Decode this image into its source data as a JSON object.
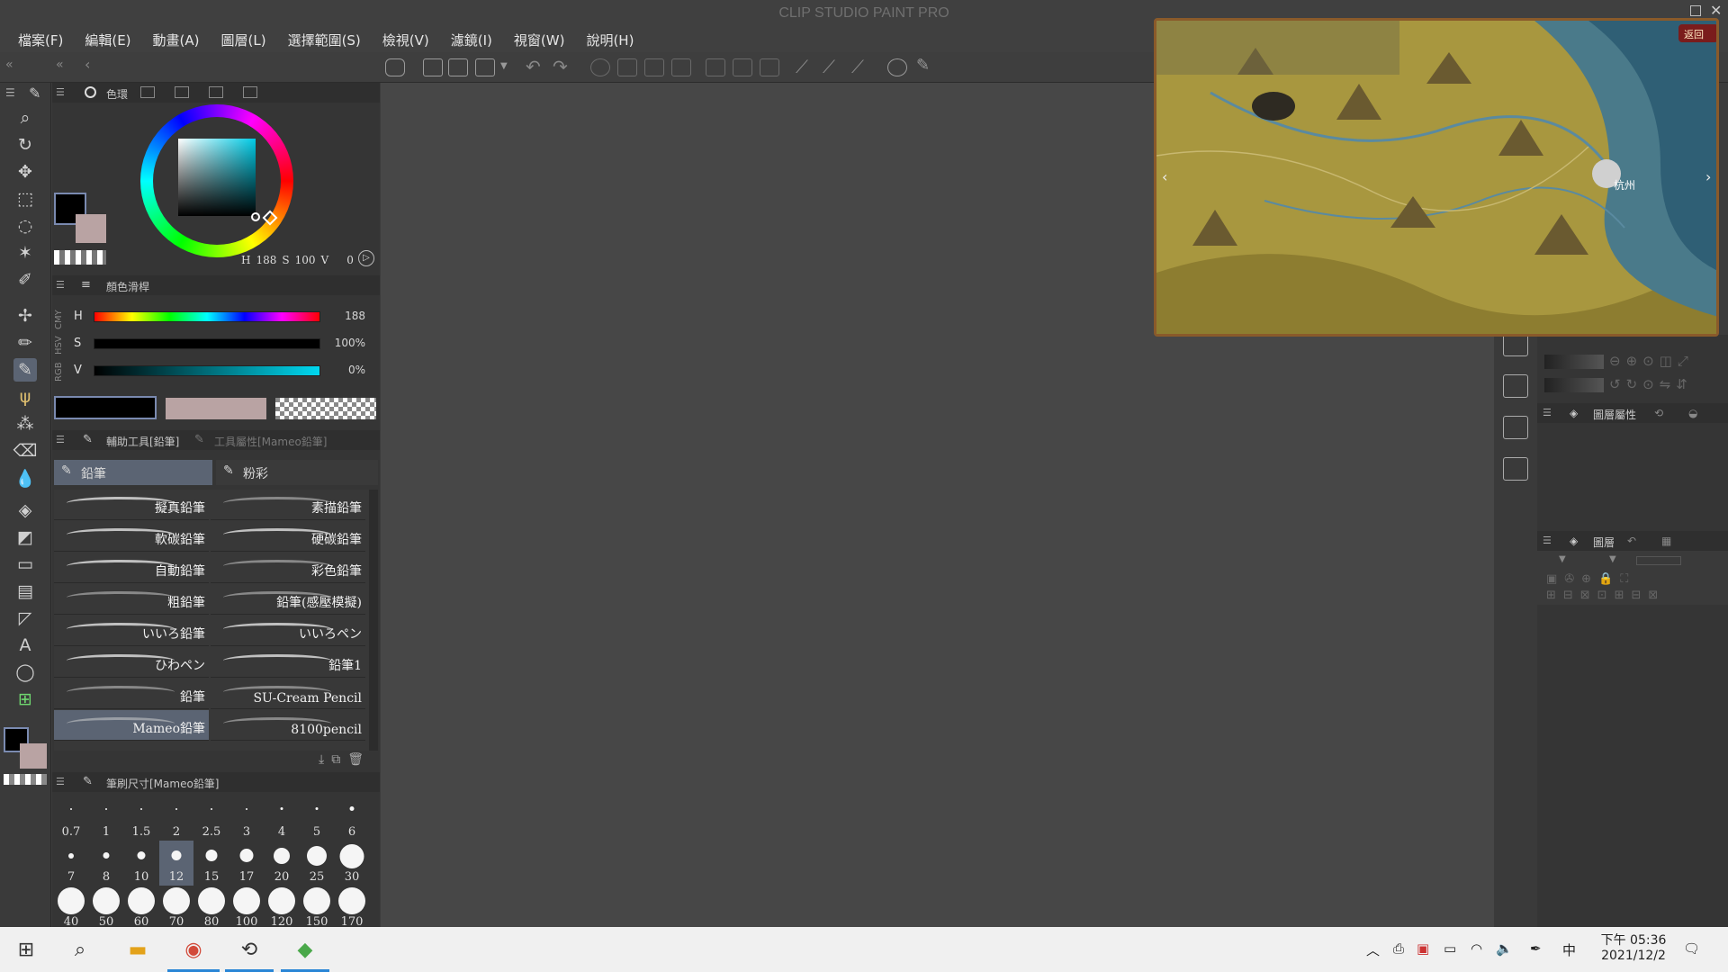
{
  "app_title": "CLIP STUDIO PAINT PRO",
  "menu": [
    "檔案(F)",
    "編輯(E)",
    "動畫(A)",
    "圖層(L)",
    "選擇範圍(S)",
    "檢視(V)",
    "濾鏡(I)",
    "視窗(W)",
    "說明(H)"
  ],
  "color_panel": {
    "tab_label": "色環",
    "h_value": "188",
    "s_value": "100",
    "v_value": "0",
    "readout_h_label": "H",
    "readout_s_label": "S",
    "readout_v_label": "V",
    "main_color": "#000000",
    "sub_color": "#b9a3a3"
  },
  "color_slider": {
    "title": "顏色滑桿",
    "side_tabs": [
      "RGB",
      "HSV",
      "CMY"
    ],
    "rows": [
      {
        "key": "H",
        "value": "188"
      },
      {
        "key": "S",
        "value": "100%"
      },
      {
        "key": "V",
        "value": "0%"
      }
    ]
  },
  "sub_tool": {
    "tab_active": "輔助工具[鉛筆]",
    "tab_inactive": "工具屬性[Mameo鉛筆]",
    "groups": [
      "鉛筆",
      "粉彩"
    ],
    "brushes_left": [
      "擬真鉛筆",
      "軟碳鉛筆",
      "自動鉛筆",
      "粗鉛筆",
      "いいろ鉛筆",
      "ひわペン",
      "鉛筆",
      "Mameo鉛筆"
    ],
    "brushes_right": [
      "素描鉛筆",
      "硬碳鉛筆",
      "彩色鉛筆",
      "鉛筆(感壓模擬)",
      "いいろペン",
      "鉛筆1",
      "SU-Cream Pencil",
      "8100pencil"
    ],
    "selected": "Mameo鉛筆"
  },
  "brush_size": {
    "title": "筆刷尺寸[Mameo鉛筆]",
    "row1": [
      "0.7",
      "1",
      "1.5",
      "2",
      "2.5",
      "3",
      "4",
      "5",
      "6"
    ],
    "row2": [
      "7",
      "8",
      "10",
      "12",
      "15",
      "17",
      "20",
      "25",
      "30"
    ],
    "row3": [
      "40",
      "50",
      "60",
      "70",
      "80",
      "100",
      "120",
      "150",
      "170"
    ],
    "selected": "12"
  },
  "right_panels": {
    "layer_property": "圖層屬性",
    "layer": "圖層"
  },
  "game_overlay": {
    "city_label": "杭州",
    "back_button": "返回"
  },
  "taskbar": {
    "time": "下午 05:36",
    "date": "2021/12/2",
    "ime": "中"
  }
}
